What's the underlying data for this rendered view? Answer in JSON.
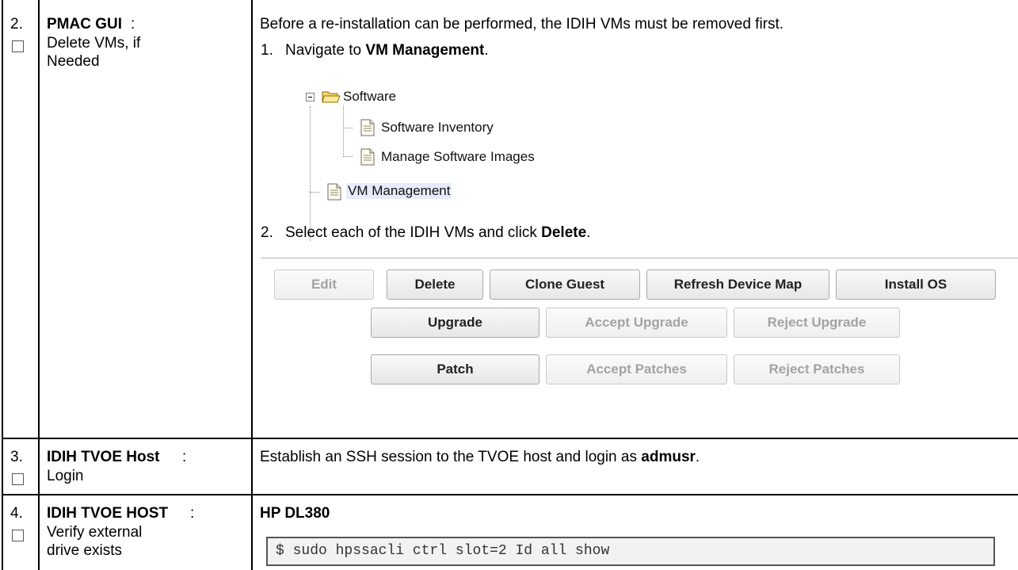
{
  "rows": [
    {
      "num": "2.",
      "title": "PMAC GUI",
      "title_suffix": ":",
      "subtitle_lines": [
        "Delete VMs, if",
        "Needed"
      ],
      "intro": "Before a re-installation can be performed, the IDIH VMs must be removed first.",
      "step1": {
        "num": "1.",
        "text": "Navigate to ",
        "bold": "VM Management",
        "end": "."
      },
      "tree": {
        "root": "Software",
        "children": [
          "Software Inventory",
          "Manage Software Images"
        ],
        "sibling": "VM Management"
      },
      "step2": {
        "num": "2.",
        "text": "Select each of the IDIH VMs and click ",
        "bold": "Delete",
        "end": "."
      },
      "buttons_row1": [
        "Edit",
        "Delete",
        "Clone Guest",
        "Refresh Device Map",
        "Install OS"
      ],
      "buttons_row2": [
        "Upgrade",
        "Accept Upgrade",
        "Reject Upgrade"
      ],
      "buttons_row3": [
        "Patch",
        "Accept Patches",
        "Reject Patches"
      ]
    },
    {
      "num": "3.",
      "title": "IDIH TVOE Host",
      "title_suffix": ":",
      "subtitle_lines": [
        "Login"
      ],
      "text": "Establish an SSH session to the TVOE host and login as ",
      "bold": "admusr",
      "end": "."
    },
    {
      "num": "4.",
      "title": "IDIH TVOE HOST",
      "title_suffix": ":",
      "subtitle_lines": [
        "Verify external",
        "drive exists"
      ],
      "heading": "HP DL380",
      "code": "$ sudo hpssacli ctrl slot=2 Id all show"
    }
  ]
}
